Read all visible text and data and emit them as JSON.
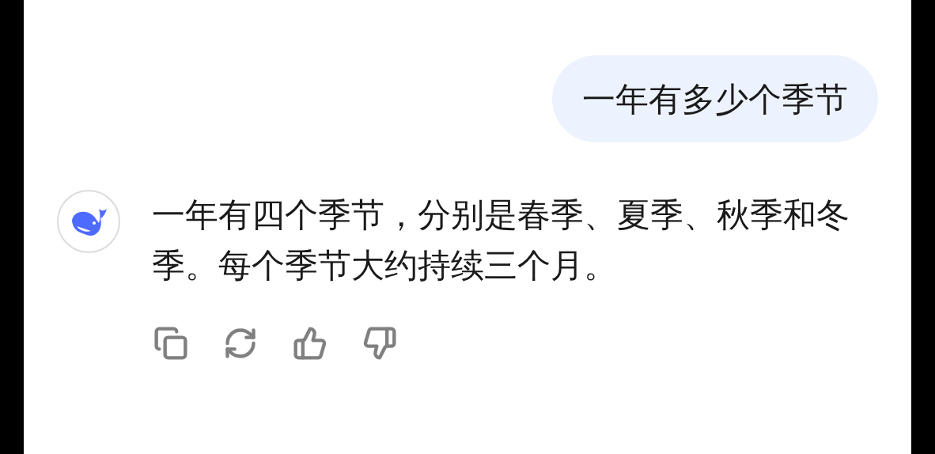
{
  "messages": [
    {
      "kind": "user",
      "text": "一年有多少个季节"
    },
    {
      "kind": "assistant",
      "text": "一年有四个季节，分别是春季、夏季、秋季和冬季。每个季节大约持续三个月。"
    }
  ]
}
